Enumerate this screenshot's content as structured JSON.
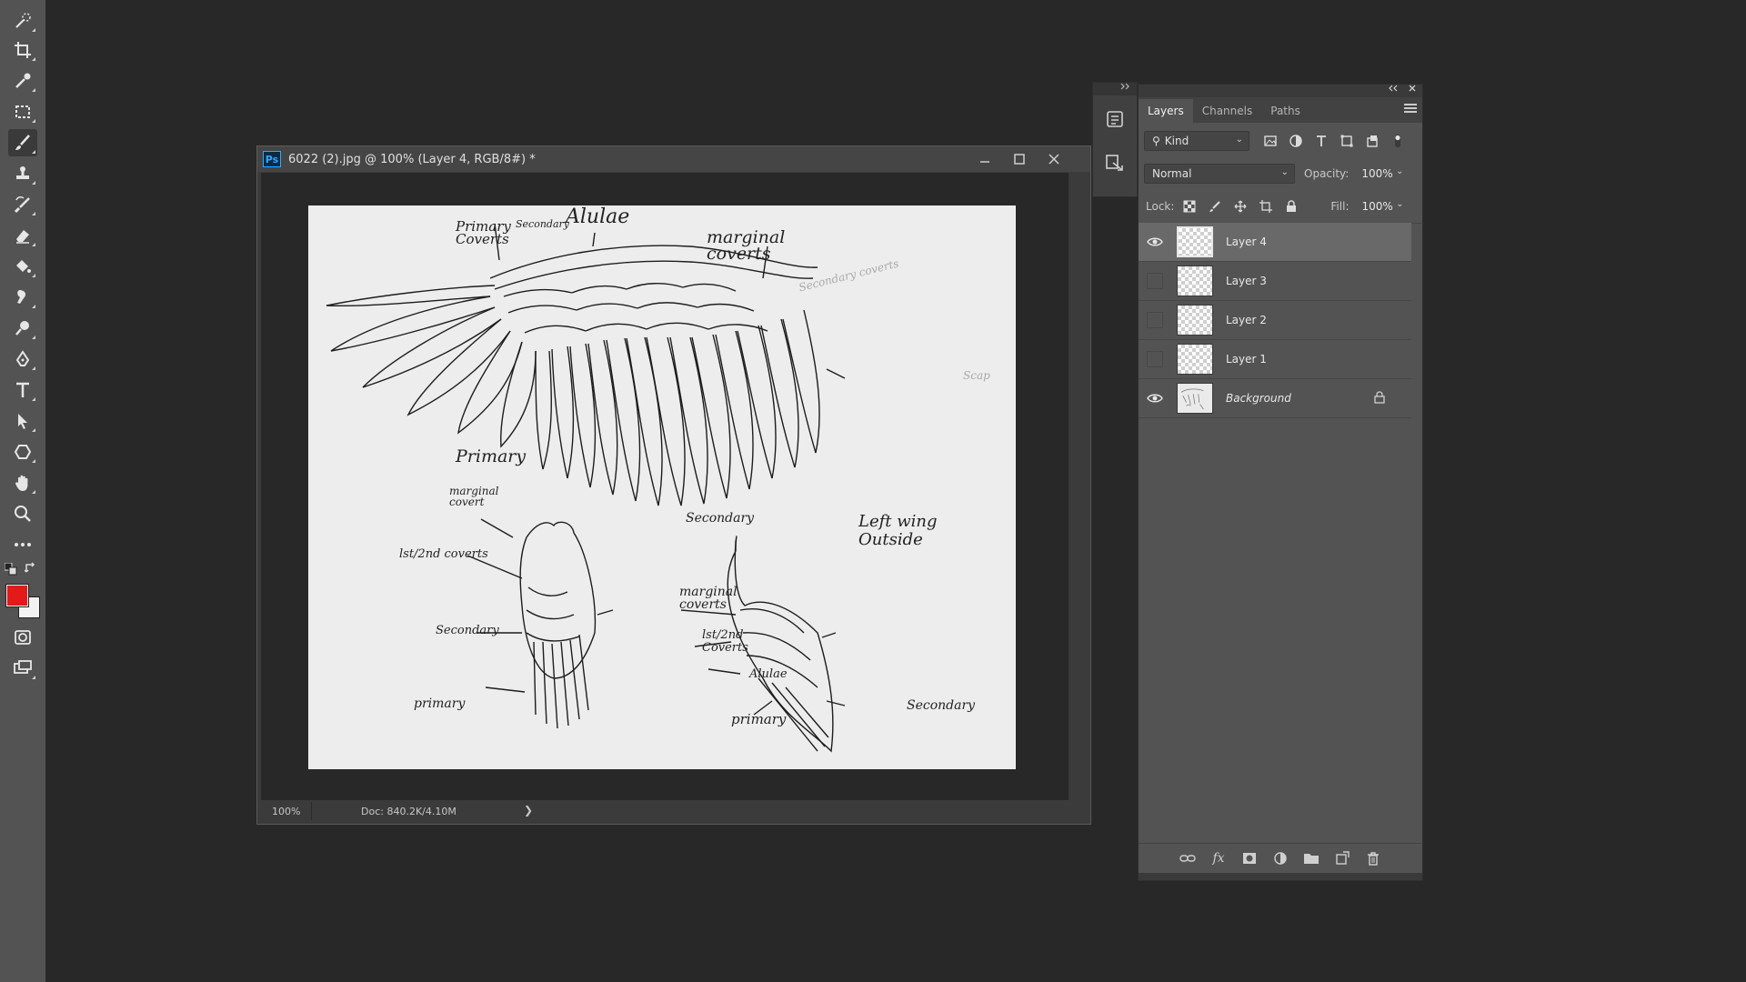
{
  "document": {
    "title": "6022 (2).jpg @ 100% (Layer 4, RGB/8#) *",
    "app_badge": "Ps",
    "zoom": "100%",
    "doc_info": "Doc: 840.2K/4.10M",
    "status_arrow": "❯"
  },
  "window_controls": {
    "minimize": "—",
    "maximize": "☐",
    "close": "✕"
  },
  "toolbar": {
    "foreground_color": "#e41a1a",
    "background_color": "#f2f2f2",
    "tools": [
      {
        "name": "quick-selection-icon",
        "glyph": "✧"
      },
      {
        "name": "crop-icon",
        "glyph": "⌗"
      },
      {
        "name": "eyedropper-icon",
        "glyph": "✎"
      },
      {
        "name": "frame-icon",
        "glyph": "⬚"
      },
      {
        "name": "brush-icon",
        "glyph": "✏"
      },
      {
        "name": "stamp-icon",
        "glyph": "♟"
      },
      {
        "name": "history-brush-icon",
        "glyph": "⟲"
      },
      {
        "name": "eraser-icon",
        "glyph": "⌫"
      },
      {
        "name": "paint-bucket-icon",
        "glyph": "⛛"
      },
      {
        "name": "smudge-icon",
        "glyph": "☝"
      },
      {
        "name": "dodge-icon",
        "glyph": "⚲"
      },
      {
        "name": "pen-icon",
        "glyph": "✒"
      },
      {
        "name": "type-icon",
        "glyph": "T"
      },
      {
        "name": "path-selection-icon",
        "glyph": "➤"
      },
      {
        "name": "shape-icon",
        "glyph": "⬡"
      },
      {
        "name": "hand-icon",
        "glyph": "✋"
      },
      {
        "name": "zoom-icon",
        "glyph": "🔍"
      },
      {
        "name": "more-tools-icon",
        "glyph": "•••"
      }
    ]
  },
  "sketch_notes": {
    "primary_coverts": "Primary\nCoverts",
    "secondary_small": "Secondary",
    "alulae": "Alulae",
    "marginal_coverts": "marginal\ncoverts",
    "secondary_coverts_faint": "Secondary coverts",
    "scap": "Scap",
    "primary": "Primary",
    "marginal_covert": "marginal\ncovert",
    "lst_2nd_coverts": "lst/2nd coverts",
    "secondary": "Secondary",
    "secondary_bottom": "Secondary",
    "primary_lower": "primary",
    "left_wing": "Left wing\nOutside",
    "marginal_coverts_2": "marginal\ncoverts",
    "lst_2nd_coverts_2": "lst/2nd\nCoverts",
    "alulae_2": "Alulae",
    "primary_2": "primary",
    "secondary_2": "Secondary"
  },
  "layers_panel": {
    "tabs": [
      "Layers",
      "Channels",
      "Paths"
    ],
    "active_tab": "Layers",
    "filter_kind": "Kind",
    "blend_mode": "Normal",
    "opacity_label": "Opacity:",
    "opacity_value": "100%",
    "lock_label": "Lock:",
    "fill_label": "Fill:",
    "fill_value": "100%",
    "layers": [
      {
        "name": "Layer 4",
        "visible": true,
        "selected": true,
        "locked": false,
        "background": false
      },
      {
        "name": "Layer 3",
        "visible": false,
        "selected": false,
        "locked": false,
        "background": false
      },
      {
        "name": "Layer 2",
        "visible": false,
        "selected": false,
        "locked": false,
        "background": false
      },
      {
        "name": "Layer 1",
        "visible": false,
        "selected": false,
        "locked": false,
        "background": false
      },
      {
        "name": "Background",
        "visible": true,
        "selected": false,
        "locked": true,
        "background": true
      }
    ]
  }
}
